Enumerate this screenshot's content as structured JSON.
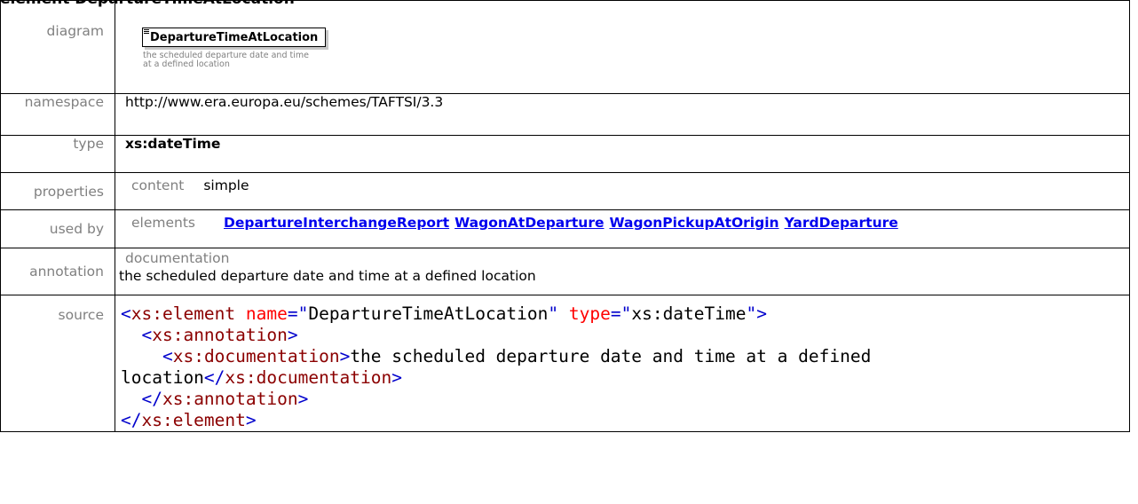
{
  "page": {
    "heading": "element DepartureTimeAtLocation"
  },
  "rows": {
    "diagram": {
      "label": "diagram",
      "element_name": "DepartureTimeAtLocation",
      "element_doc": "the scheduled departure date and time at a defined location"
    },
    "namespace": {
      "label": "namespace",
      "value": "http://www.era.europa.eu/schemes/TAFTSI/3.3"
    },
    "type": {
      "label": "type",
      "value": "xs:dateTime"
    },
    "properties": {
      "label": "properties",
      "key": "content",
      "value": "simple"
    },
    "used_by": {
      "label": "used by",
      "key": "elements",
      "links": [
        "DepartureInterchangeReport",
        "WagonAtDeparture",
        "WagonPickupAtOrigin",
        "YardDeparture"
      ]
    },
    "annotation": {
      "label": "annotation",
      "key": "documentation",
      "value": "the scheduled departure date and time at a defined location"
    },
    "source": {
      "label": "source",
      "line1": {
        "open": "<",
        "tag": "xs:element",
        "attr1": "name",
        "eq": "=\"",
        "val1": "DepartureTimeAtLocation",
        "q": "\"",
        "attr2": "type",
        "val2": "xs:dateTime",
        "close": ">"
      },
      "line2_tag": "xs:annotation",
      "line3_tag": "xs:documentation",
      "doc_text_a": "the scheduled departure date and time at a defined",
      "doc_text_b": "location",
      "line5_tag": "xs:annotation",
      "line6_tag": "xs:element"
    }
  }
}
